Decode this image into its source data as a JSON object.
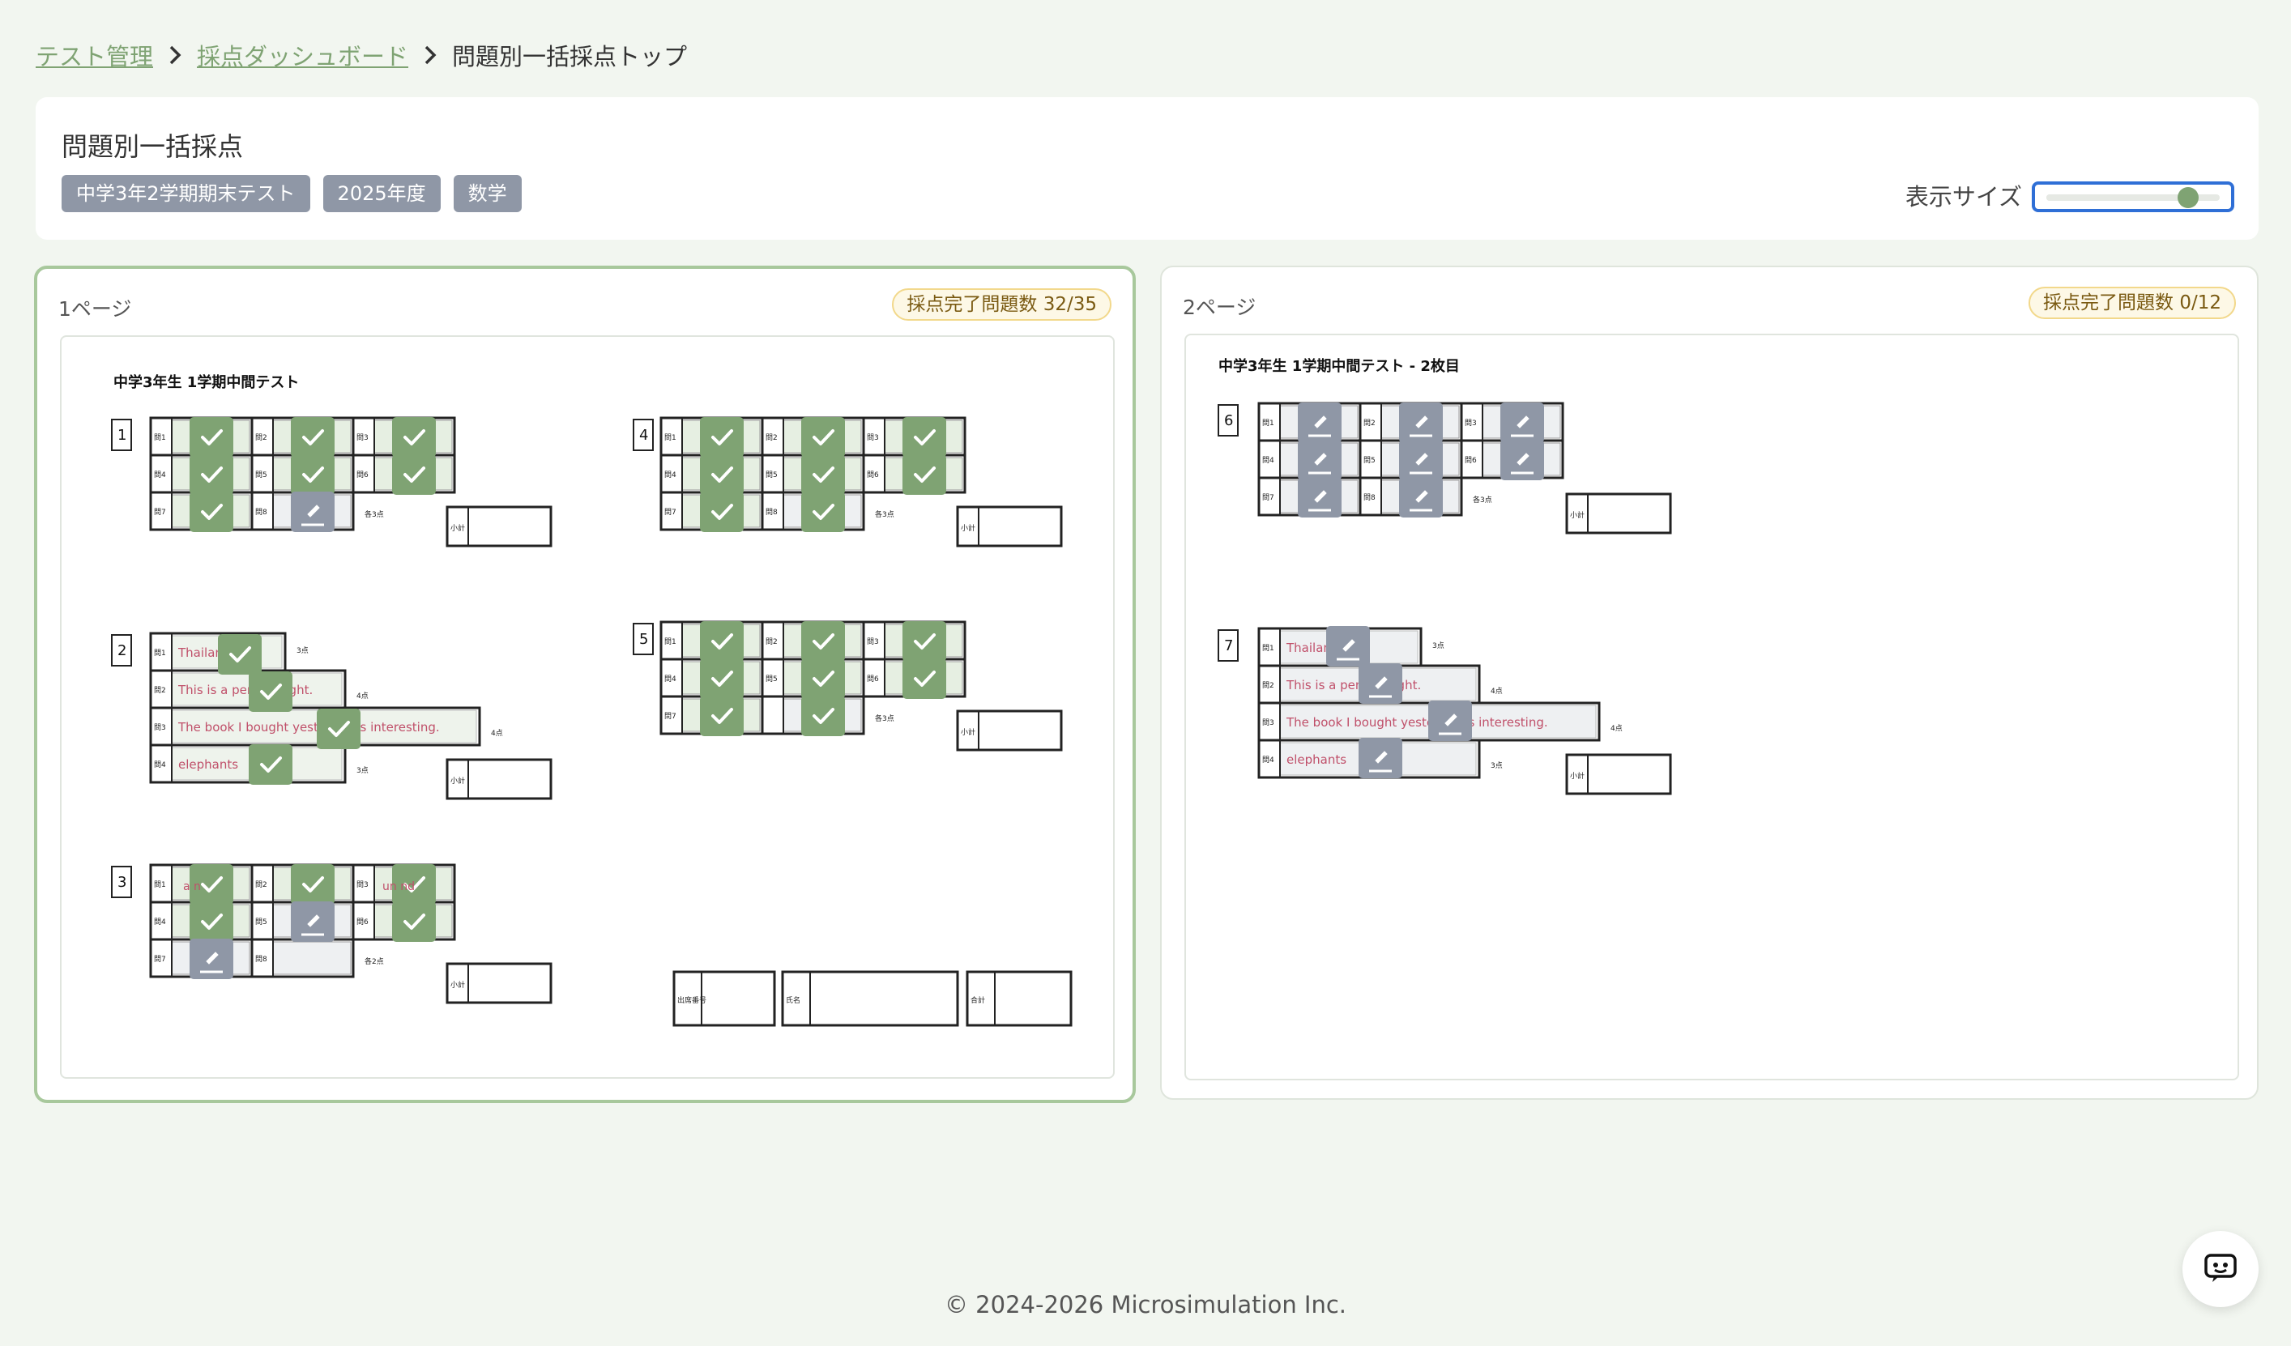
{
  "breadcrumb": {
    "items": [
      {
        "label": "テスト管理",
        "link": true
      },
      {
        "label": "採点ダッシュボード",
        "link": true
      },
      {
        "label": "問題別一括採点トップ",
        "link": false
      }
    ]
  },
  "header": {
    "title": "問題別一括採点",
    "tags": [
      "中学3年2学期期末テスト",
      "2025年度",
      "数学"
    ],
    "size_label": "表示サイズ",
    "size_value": 0.82
  },
  "pages": [
    {
      "label": "1ページ",
      "progress": "採点完了問題数 32/35",
      "sheet_title": "中学3年生 1学期中間テスト",
      "section_numbers": [
        "1",
        "2",
        "3",
        "4",
        "5"
      ],
      "grid_labels_a": [
        "問1",
        "問2",
        "問3",
        "問4",
        "問5",
        "問6",
        "問7",
        "問8"
      ],
      "grid_labels_b": [
        "問1",
        "問2",
        "問3",
        "問4",
        "問5",
        "問6",
        "問7"
      ],
      "points_each3": "各3点",
      "points_each2": "各2点",
      "subtotal": "小計",
      "text_rows": {
        "row_labels": [
          "問1",
          "問2",
          "問3",
          "問4"
        ],
        "answers": [
          "Thailand",
          "This is a pen I bought.",
          "The book I bought yesterday is interesting.",
          "elephants"
        ],
        "points": [
          "3点",
          "4点",
          "4点",
          "3点"
        ]
      },
      "q3_answers": [
        "a    n",
        "un        nd"
      ],
      "footer_boxes": [
        "出席番号",
        "氏名",
        "合計"
      ]
    },
    {
      "label": "2ページ",
      "progress": "採点完了問題数 0/12",
      "sheet_title": "中学3年生 1学期中間テスト - 2枚目",
      "section_numbers": [
        "6",
        "7"
      ],
      "grid_labels_a": [
        "問1",
        "問2",
        "問3",
        "問4",
        "問5",
        "問6",
        "問7",
        "問8"
      ],
      "points_each3": "各3点",
      "subtotal": "小計",
      "text_rows": {
        "row_labels": [
          "問1",
          "問2",
          "問3",
          "問4"
        ],
        "answers": [
          "Thailand",
          "This is a pen I bought.",
          "The book I bought yesterday is interesting.",
          "elephants"
        ],
        "points": [
          "3点",
          "4点",
          "4点",
          "3点"
        ]
      }
    }
  ],
  "colors": {
    "graded": "#7fa373",
    "ungraded": "#8f97a6",
    "accent": "#7fa373",
    "answer_text": "#c0506a"
  },
  "footer": {
    "copyright": "© 2024-2026 Microsimulation Inc."
  },
  "chat": {
    "icon": "chat-bot-icon"
  }
}
